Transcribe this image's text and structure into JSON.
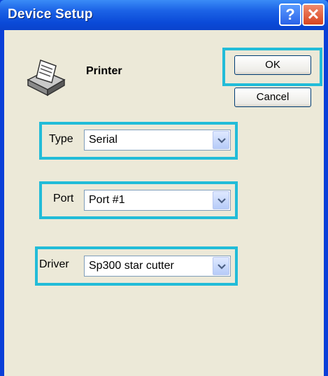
{
  "window": {
    "title": "Device Setup"
  },
  "titlebar": {
    "help_label": "?",
    "close_label": "✕"
  },
  "device": {
    "heading": "Printer",
    "icon": "printer-icon"
  },
  "buttons": {
    "ok_label": "OK",
    "cancel_label": "Cancel"
  },
  "fields": {
    "type": {
      "label": "Type",
      "value": "Serial"
    },
    "port": {
      "label": "Port",
      "value": "Port #1"
    },
    "driver": {
      "label": "Driver",
      "value": "Sp300 star cutter"
    }
  },
  "colors": {
    "highlight": "#22bcd8",
    "titlebar": "#0a4ad8",
    "dialog_bg": "#ece9d8"
  }
}
